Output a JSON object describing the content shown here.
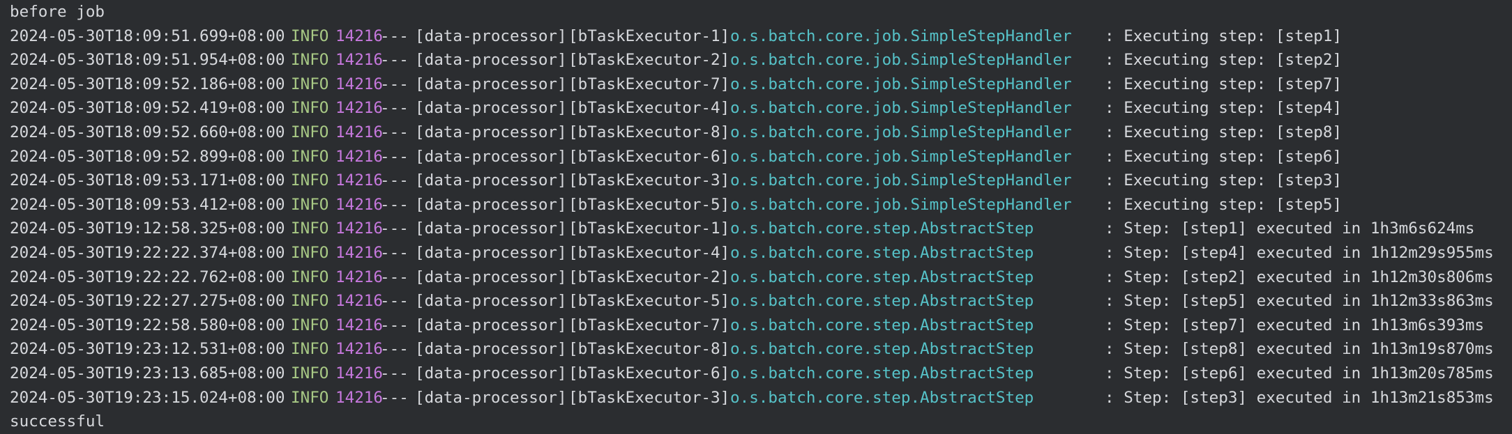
{
  "console": {
    "header_line": "before job",
    "footer_line": "successful",
    "colors": {
      "background": "#2b2d30",
      "text": "#d6d8dc",
      "level": "#a8c985",
      "pid": "#c678dd",
      "logger": "#56c2c8"
    },
    "entries": [
      {
        "timestamp": "2024-05-30T18:09:51.699+08:00",
        "level": "INFO",
        "pid": "14216",
        "sep": "---",
        "app": "[data-processor]",
        "thread": "[bTaskExecutor-1]",
        "logger": "o.s.batch.core.job.SimpleStepHandler",
        "message": ": Executing step: [step1]"
      },
      {
        "timestamp": "2024-05-30T18:09:51.954+08:00",
        "level": "INFO",
        "pid": "14216",
        "sep": "---",
        "app": "[data-processor]",
        "thread": "[bTaskExecutor-2]",
        "logger": "o.s.batch.core.job.SimpleStepHandler",
        "message": ": Executing step: [step2]"
      },
      {
        "timestamp": "2024-05-30T18:09:52.186+08:00",
        "level": "INFO",
        "pid": "14216",
        "sep": "---",
        "app": "[data-processor]",
        "thread": "[bTaskExecutor-7]",
        "logger": "o.s.batch.core.job.SimpleStepHandler",
        "message": ": Executing step: [step7]"
      },
      {
        "timestamp": "2024-05-30T18:09:52.419+08:00",
        "level": "INFO",
        "pid": "14216",
        "sep": "---",
        "app": "[data-processor]",
        "thread": "[bTaskExecutor-4]",
        "logger": "o.s.batch.core.job.SimpleStepHandler",
        "message": ": Executing step: [step4]"
      },
      {
        "timestamp": "2024-05-30T18:09:52.660+08:00",
        "level": "INFO",
        "pid": "14216",
        "sep": "---",
        "app": "[data-processor]",
        "thread": "[bTaskExecutor-8]",
        "logger": "o.s.batch.core.job.SimpleStepHandler",
        "message": ": Executing step: [step8]"
      },
      {
        "timestamp": "2024-05-30T18:09:52.899+08:00",
        "level": "INFO",
        "pid": "14216",
        "sep": "---",
        "app": "[data-processor]",
        "thread": "[bTaskExecutor-6]",
        "logger": "o.s.batch.core.job.SimpleStepHandler",
        "message": ": Executing step: [step6]"
      },
      {
        "timestamp": "2024-05-30T18:09:53.171+08:00",
        "level": "INFO",
        "pid": "14216",
        "sep": "---",
        "app": "[data-processor]",
        "thread": "[bTaskExecutor-3]",
        "logger": "o.s.batch.core.job.SimpleStepHandler",
        "message": ": Executing step: [step3]"
      },
      {
        "timestamp": "2024-05-30T18:09:53.412+08:00",
        "level": "INFO",
        "pid": "14216",
        "sep": "---",
        "app": "[data-processor]",
        "thread": "[bTaskExecutor-5]",
        "logger": "o.s.batch.core.job.SimpleStepHandler",
        "message": ": Executing step: [step5]"
      },
      {
        "timestamp": "2024-05-30T19:12:58.325+08:00",
        "level": "INFO",
        "pid": "14216",
        "sep": "---",
        "app": "[data-processor]",
        "thread": "[bTaskExecutor-1]",
        "logger": "o.s.batch.core.step.AbstractStep",
        "message": ": Step: [step1] executed in 1h3m6s624ms"
      },
      {
        "timestamp": "2024-05-30T19:22:22.374+08:00",
        "level": "INFO",
        "pid": "14216",
        "sep": "---",
        "app": "[data-processor]",
        "thread": "[bTaskExecutor-4]",
        "logger": "o.s.batch.core.step.AbstractStep",
        "message": ": Step: [step4] executed in 1h12m29s955ms"
      },
      {
        "timestamp": "2024-05-30T19:22:22.762+08:00",
        "level": "INFO",
        "pid": "14216",
        "sep": "---",
        "app": "[data-processor]",
        "thread": "[bTaskExecutor-2]",
        "logger": "o.s.batch.core.step.AbstractStep",
        "message": ": Step: [step2] executed in 1h12m30s806ms"
      },
      {
        "timestamp": "2024-05-30T19:22:27.275+08:00",
        "level": "INFO",
        "pid": "14216",
        "sep": "---",
        "app": "[data-processor]",
        "thread": "[bTaskExecutor-5]",
        "logger": "o.s.batch.core.step.AbstractStep",
        "message": ": Step: [step5] executed in 1h12m33s863ms"
      },
      {
        "timestamp": "2024-05-30T19:22:58.580+08:00",
        "level": "INFO",
        "pid": "14216",
        "sep": "---",
        "app": "[data-processor]",
        "thread": "[bTaskExecutor-7]",
        "logger": "o.s.batch.core.step.AbstractStep",
        "message": ": Step: [step7] executed in 1h13m6s393ms"
      },
      {
        "timestamp": "2024-05-30T19:23:12.531+08:00",
        "level": "INFO",
        "pid": "14216",
        "sep": "---",
        "app": "[data-processor]",
        "thread": "[bTaskExecutor-8]",
        "logger": "o.s.batch.core.step.AbstractStep",
        "message": ": Step: [step8] executed in 1h13m19s870ms"
      },
      {
        "timestamp": "2024-05-30T19:23:13.685+08:00",
        "level": "INFO",
        "pid": "14216",
        "sep": "---",
        "app": "[data-processor]",
        "thread": "[bTaskExecutor-6]",
        "logger": "o.s.batch.core.step.AbstractStep",
        "message": ": Step: [step6] executed in 1h13m20s785ms"
      },
      {
        "timestamp": "2024-05-30T19:23:15.024+08:00",
        "level": "INFO",
        "pid": "14216",
        "sep": "---",
        "app": "[data-processor]",
        "thread": "[bTaskExecutor-3]",
        "logger": "o.s.batch.core.step.AbstractStep",
        "message": ": Step: [step3] executed in 1h13m21s853ms"
      }
    ]
  }
}
